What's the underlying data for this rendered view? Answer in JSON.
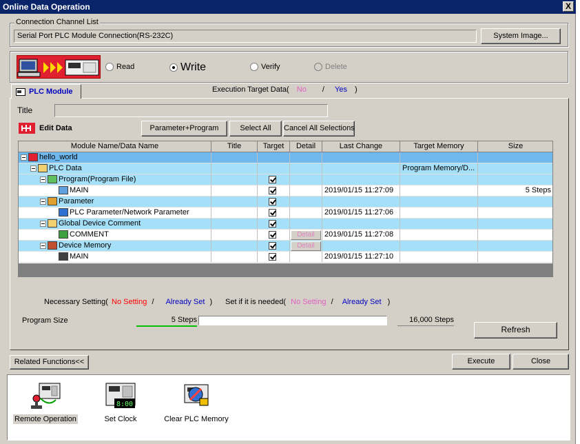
{
  "window": {
    "title": "Online Data Operation",
    "close_label": "X"
  },
  "connection": {
    "caption": "Connection Channel List",
    "channel_value": "Serial Port  PLC Module Connection(RS-232C)",
    "system_image_button": "System Image..."
  },
  "operation": {
    "read_label": "Read",
    "write_label": "Write",
    "verify_label": "Verify",
    "delete_label": "Delete",
    "selected": "Write"
  },
  "tab": {
    "label": "PLC Module"
  },
  "execution_target": {
    "prefix": "Execution Target Data(",
    "no": "No",
    "slash": "/",
    "yes": "Yes",
    "suffix": ")"
  },
  "title_field": {
    "label": "Title",
    "value": ""
  },
  "edit_data": {
    "label": "Edit Data",
    "param_program_button": "Parameter+Program",
    "select_all_button": "Select All",
    "cancel_all_button": "Cancel All Selections"
  },
  "table": {
    "headers": [
      "Module Name/Data Name",
      "Title",
      "Target",
      "Detail",
      "Last Change",
      "Target Memory",
      "Size"
    ],
    "rows": [
      {
        "name": "hello_world",
        "indent": 0,
        "icon": "project-icon",
        "expander": true,
        "checked": false,
        "detail": "",
        "last_change": "",
        "memory": "",
        "size": "",
        "selected": true
      },
      {
        "name": "PLC Data",
        "indent": 1,
        "icon": "folder-icon",
        "expander": true,
        "checked": false,
        "detail": "",
        "last_change": "",
        "memory": "Program Memory/D...",
        "size": "",
        "band": true
      },
      {
        "name": "Program(Program File)",
        "indent": 2,
        "icon": "program-folder-icon",
        "expander": true,
        "checked": true,
        "detail": "",
        "last_change": "",
        "memory": "",
        "size": "",
        "band": true
      },
      {
        "name": "MAIN",
        "indent": 3,
        "icon": "program-file-icon",
        "expander": false,
        "checked": true,
        "detail": "",
        "last_change": "2019/01/15 11:27:09",
        "memory": "",
        "size": "5 Steps"
      },
      {
        "name": "Parameter",
        "indent": 2,
        "icon": "parameter-folder-icon",
        "expander": true,
        "checked": true,
        "detail": "",
        "last_change": "",
        "memory": "",
        "size": "",
        "band": true
      },
      {
        "name": "PLC Parameter/Network Parameter",
        "indent": 3,
        "icon": "parameter-file-icon",
        "expander": false,
        "checked": true,
        "detail": "",
        "last_change": "2019/01/15 11:27:06",
        "memory": "",
        "size": ""
      },
      {
        "name": "Global Device Comment",
        "indent": 2,
        "icon": "folder-icon",
        "expander": true,
        "checked": true,
        "detail": "",
        "last_change": "",
        "memory": "",
        "size": "",
        "band": true
      },
      {
        "name": "COMMENT",
        "indent": 3,
        "icon": "comment-file-icon",
        "expander": false,
        "checked": true,
        "detail": "Detail",
        "last_change": "2019/01/15 11:27:08",
        "memory": "",
        "size": ""
      },
      {
        "name": "Device Memory",
        "indent": 2,
        "icon": "device-memory-folder-icon",
        "expander": true,
        "checked": true,
        "detail": "Detail",
        "last_change": "",
        "memory": "",
        "size": "",
        "band": true
      },
      {
        "name": "MAIN",
        "indent": 3,
        "icon": "device-memory-file-icon",
        "expander": false,
        "checked": true,
        "detail": "",
        "last_change": "2019/01/15 11:27:10",
        "memory": "",
        "size": ""
      }
    ]
  },
  "legend": {
    "necessary_prefix": "Necessary Setting(",
    "no_setting": "No Setting",
    "slash": "/",
    "already_set": "Already Set",
    "optional_prefix": "Set if it is needed(",
    "optional_no_setting": "No Setting",
    "optional_slash": "/",
    "optional_already_set": "Already Set",
    "suffix": ")"
  },
  "program_size": {
    "label": "Program Size",
    "used": "5 Steps",
    "total": "16,000 Steps",
    "fraction": 0.0003
  },
  "buttons": {
    "refresh": "Refresh",
    "related_functions": "Related Functions<<",
    "execute": "Execute",
    "close": "Close"
  },
  "related": {
    "items": [
      {
        "label": "Remote Operation",
        "icon": "remote-operation-icon"
      },
      {
        "label": "Set Clock",
        "icon": "set-clock-icon",
        "clock_text": "8:00"
      },
      {
        "label": "Clear PLC Memory",
        "icon": "clear-plc-memory-icon"
      }
    ]
  },
  "colors": {
    "titlebar": "#0a246a",
    "row_band": "#a6e0f8",
    "row_selected": "#6eb8ee",
    "no_setting": "#ff0000",
    "already_set": "#0000c0",
    "pink": "#e060c0"
  }
}
